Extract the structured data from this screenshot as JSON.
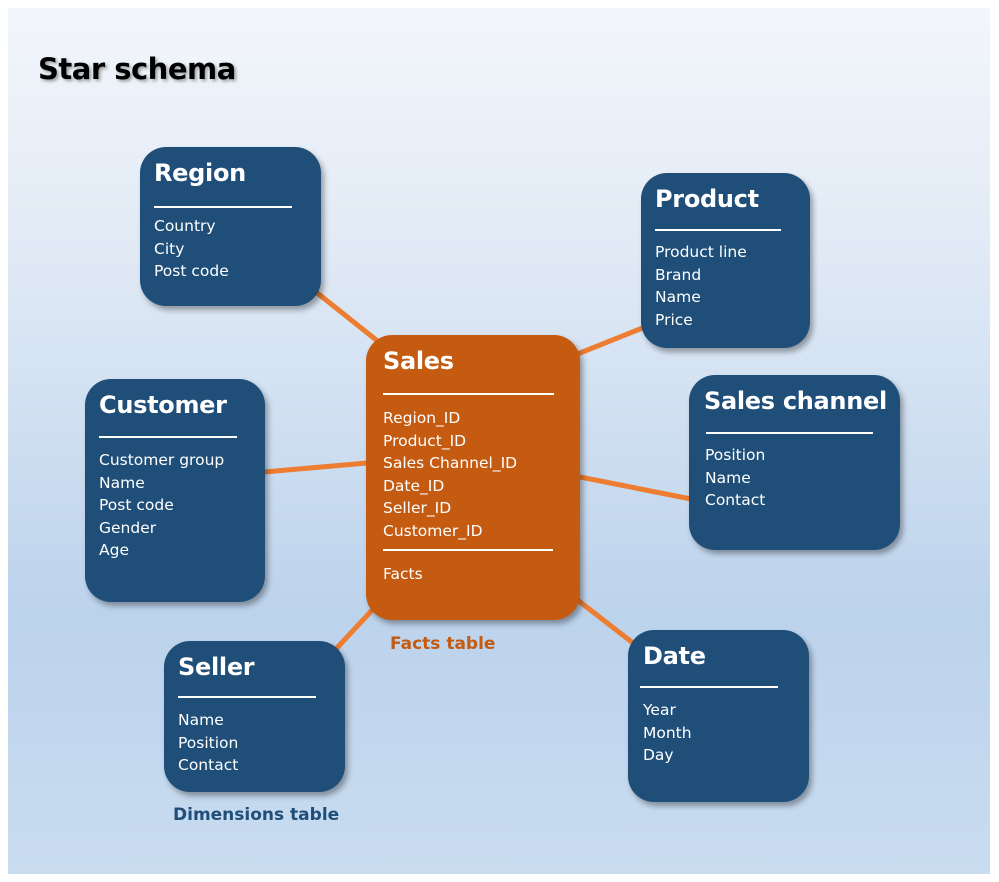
{
  "title": "Star schema",
  "colors": {
    "dimension_box": "#1f4e79",
    "fact_box": "#c55a11",
    "connector": "#ed7d31",
    "fact_caption": "#c55a11",
    "dimension_caption": "#1f4e79"
  },
  "fact_table": {
    "name": "Sales",
    "keys": [
      "Region_ID",
      "Product_ID",
      "Sales Channel_ID",
      "Date_ID",
      "Seller_ID",
      "Customer_ID"
    ],
    "facts": [
      "Facts"
    ]
  },
  "dimensions": {
    "region": {
      "name": "Region",
      "fields": [
        "Country",
        "City",
        "Post code"
      ]
    },
    "product": {
      "name": "Product",
      "fields": [
        "Product line",
        "Brand",
        "Name",
        "Price"
      ]
    },
    "customer": {
      "name": "Customer",
      "fields": [
        "Customer group",
        "Name",
        "Post code",
        "Gender",
        "Age"
      ]
    },
    "sales_channel": {
      "name": "Sales channel",
      "fields": [
        "Position",
        "Name",
        "Contact"
      ]
    },
    "seller": {
      "name": "Seller",
      "fields": [
        "Name",
        "Position",
        "Contact"
      ]
    },
    "date": {
      "name": "Date",
      "fields": [
        "Year",
        "Month",
        "Day"
      ]
    }
  },
  "captions": {
    "facts_table": "Facts table",
    "dimensions_table": "Dimensions table"
  }
}
